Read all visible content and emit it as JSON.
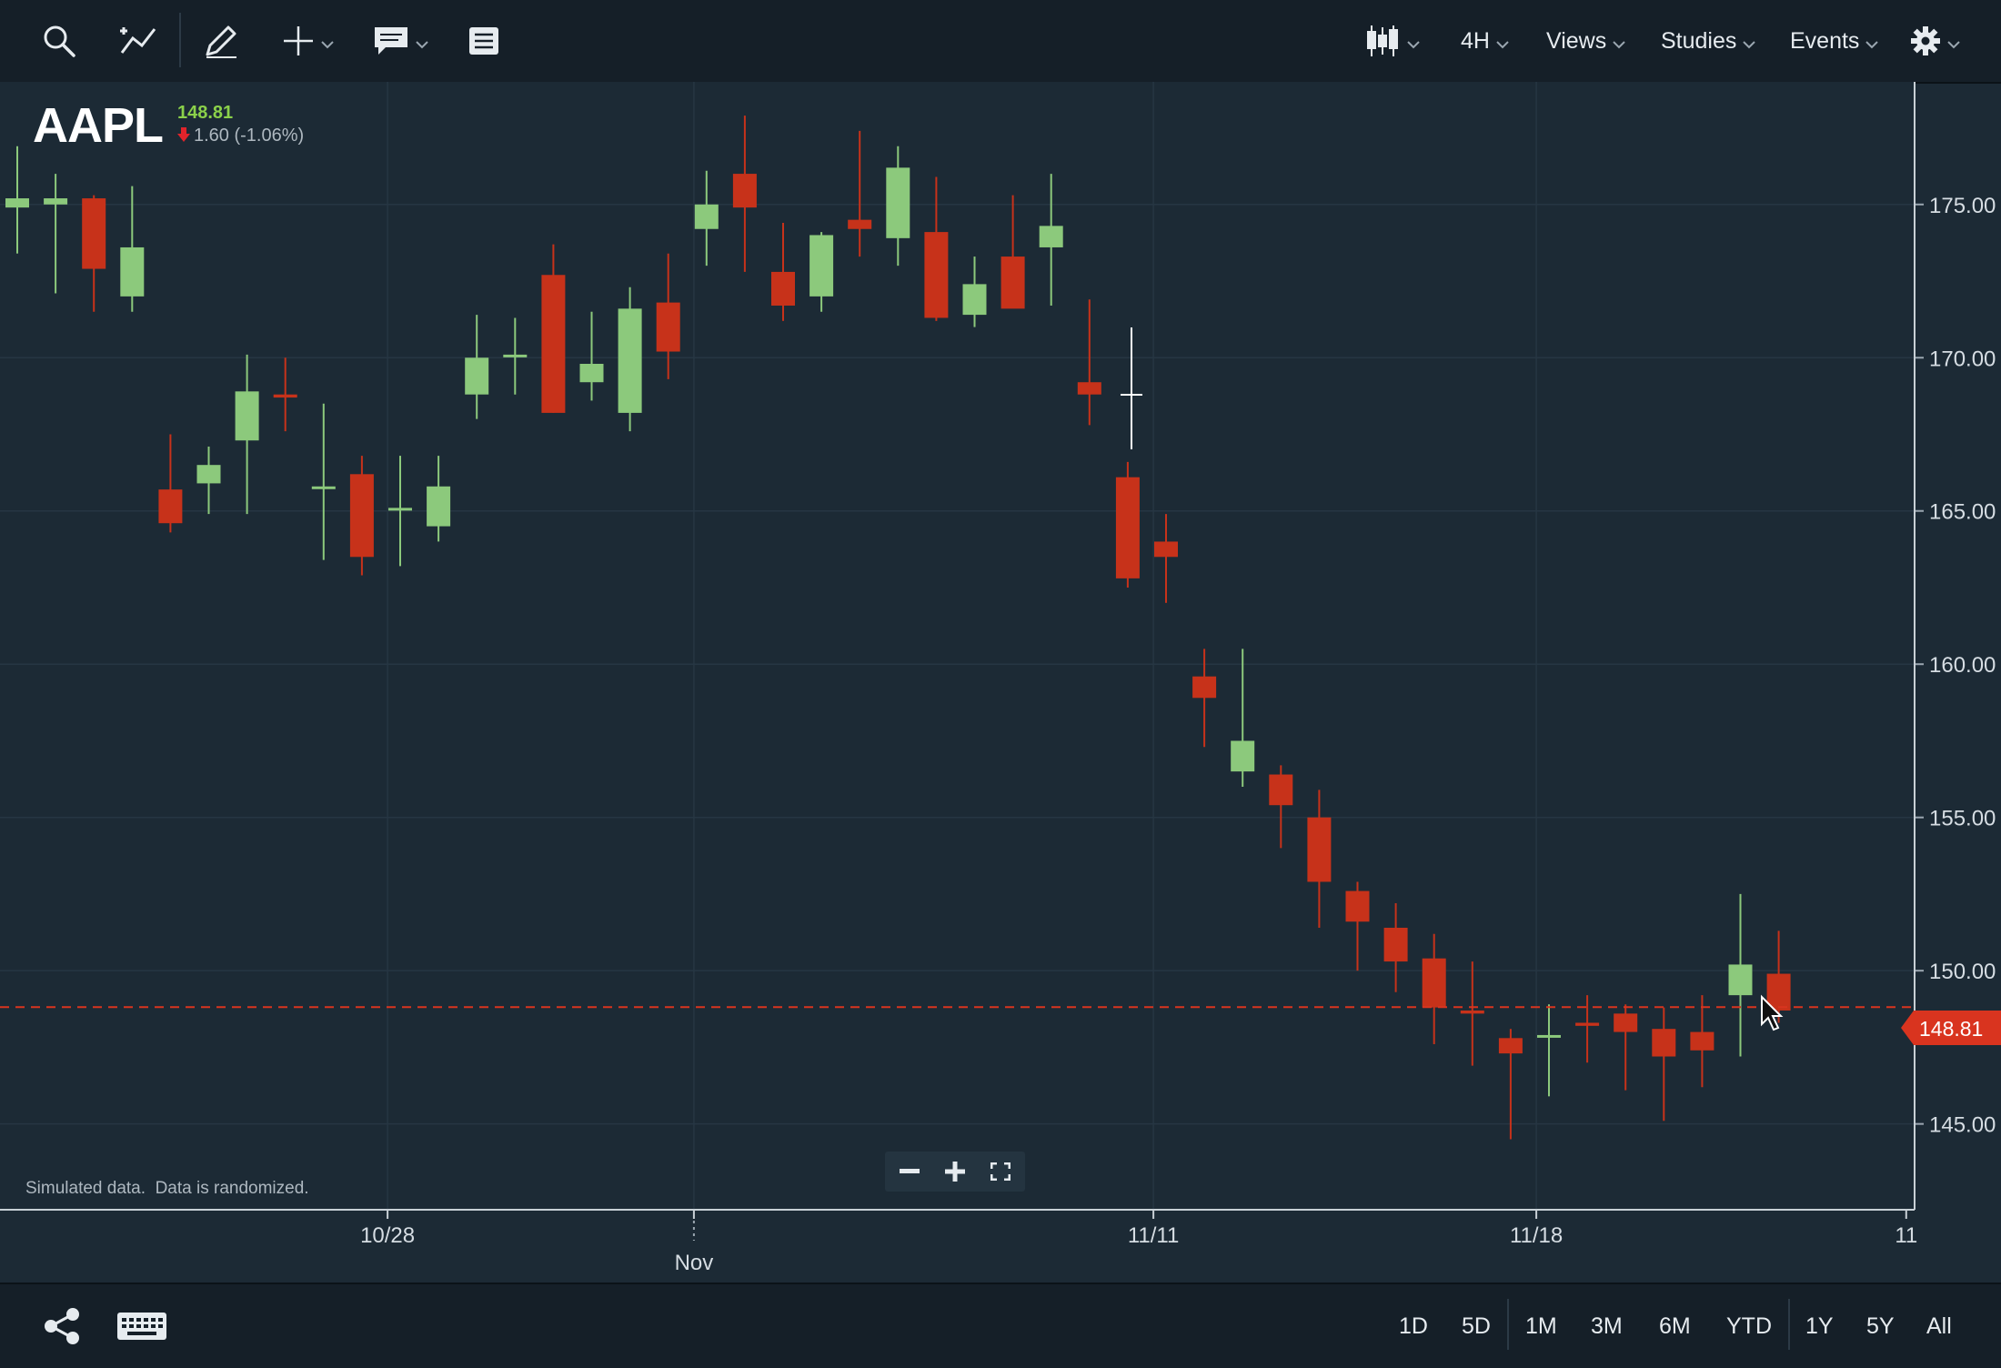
{
  "toolbar": {
    "icons": [
      "search-icon",
      "trendline-icon",
      "pencil-icon",
      "crosshair-icon",
      "comment-icon",
      "news-icon"
    ],
    "chart_type_icon": "candlestick-icon",
    "interval_label": "4H",
    "views_label": "Views",
    "studies_label": "Studies",
    "events_label": "Events",
    "settings_icon": "gear-icon"
  },
  "quote": {
    "symbol": "AAPL",
    "last_price": "148.81",
    "change": "1.60 (-1.06%)",
    "direction": "down"
  },
  "notice": "Simulated data.  Data is randomized.",
  "price_badge": "148.81",
  "colors": {
    "background": "#1c2a35",
    "up": "#8cc97c",
    "down": "#c7321a",
    "price_line": "#d9341f",
    "quote_up_text": "#8bd14a",
    "down_arrow": "#e0242b"
  },
  "chart_data": {
    "type": "candlestick",
    "symbol": "AAPL",
    "interval": "4H",
    "ylim": [
      142.2,
      179.0
    ],
    "y_ticks": [
      "175.00",
      "170.00",
      "165.00",
      "160.00",
      "155.00",
      "150.00",
      "145.00"
    ],
    "y_tick_values": [
      175,
      170,
      165,
      160,
      155,
      150,
      145
    ],
    "x_tick_labels": [
      {
        "label": "10/28",
        "index": 9.67
      },
      {
        "label": "Nov",
        "index": 17.67
      },
      {
        "label": "11/11",
        "index": 29.67
      },
      {
        "label": "11/18",
        "index": 39.67
      },
      {
        "label": "11",
        "index": 49.33
      }
    ],
    "last_price": 148.81,
    "candles": [
      {
        "o": 174.9,
        "h": 176.9,
        "l": 173.4,
        "c": 175.2
      },
      {
        "o": 175.0,
        "h": 176.0,
        "l": 172.1,
        "c": 175.2
      },
      {
        "o": 175.2,
        "h": 175.3,
        "l": 171.5,
        "c": 172.9
      },
      {
        "o": 172.0,
        "h": 175.6,
        "l": 171.5,
        "c": 173.6
      },
      {
        "o": 165.7,
        "h": 167.5,
        "l": 164.3,
        "c": 164.6
      },
      {
        "o": 165.9,
        "h": 167.1,
        "l": 164.9,
        "c": 166.5
      },
      {
        "o": 167.3,
        "h": 170.1,
        "l": 164.9,
        "c": 168.9
      },
      {
        "o": 168.8,
        "h": 170.0,
        "l": 167.6,
        "c": 168.7
      },
      {
        "o": 165.8,
        "h": 168.5,
        "l": 163.4,
        "c": 165.8
      },
      {
        "o": 166.2,
        "h": 166.8,
        "l": 162.9,
        "c": 163.5
      },
      {
        "o": 165.1,
        "h": 166.8,
        "l": 163.2,
        "c": 165.1
      },
      {
        "o": 164.5,
        "h": 166.8,
        "l": 164.0,
        "c": 165.8
      },
      {
        "o": 168.8,
        "h": 171.4,
        "l": 168.0,
        "c": 170.0
      },
      {
        "o": 170.1,
        "h": 171.3,
        "l": 168.8,
        "c": 170.1
      },
      {
        "o": 172.7,
        "h": 173.7,
        "l": 168.2,
        "c": 168.2
      },
      {
        "o": 169.2,
        "h": 171.5,
        "l": 168.6,
        "c": 169.8
      },
      {
        "o": 168.2,
        "h": 172.3,
        "l": 167.6,
        "c": 171.6
      },
      {
        "o": 171.8,
        "h": 173.4,
        "l": 169.3,
        "c": 170.2
      },
      {
        "o": 174.2,
        "h": 176.1,
        "l": 173.0,
        "c": 175.0
      },
      {
        "o": 176.0,
        "h": 177.9,
        "l": 172.8,
        "c": 174.9
      },
      {
        "o": 172.8,
        "h": 174.4,
        "l": 171.2,
        "c": 171.7
      },
      {
        "o": 172.0,
        "h": 174.1,
        "l": 171.5,
        "c": 174.0
      },
      {
        "o": 174.5,
        "h": 177.4,
        "l": 173.3,
        "c": 174.2
      },
      {
        "o": 173.9,
        "h": 176.9,
        "l": 173.0,
        "c": 176.2
      },
      {
        "o": 174.1,
        "h": 175.9,
        "l": 171.2,
        "c": 171.3
      },
      {
        "o": 171.4,
        "h": 173.3,
        "l": 171.0,
        "c": 172.4
      },
      {
        "o": 173.3,
        "h": 175.3,
        "l": 172.1,
        "c": 171.6
      },
      {
        "o": 173.6,
        "h": 176.0,
        "l": 171.7,
        "c": 174.3
      },
      {
        "o": 169.2,
        "h": 171.9,
        "l": 167.8,
        "c": 168.8
      }
    ],
    "candles_2": [
      {
        "o": 166.1,
        "h": 166.6,
        "l": 162.5,
        "c": 162.8
      },
      {
        "o": 164.0,
        "h": 164.9,
        "l": 162.0,
        "c": 163.5
      },
      {
        "o": 159.6,
        "h": 160.5,
        "l": 157.3,
        "c": 158.9
      },
      {
        "o": 156.5,
        "h": 160.5,
        "l": 156.0,
        "c": 157.5
      },
      {
        "o": 156.4,
        "h": 156.7,
        "l": 154.0,
        "c": 155.4
      },
      {
        "o": 155.0,
        "h": 155.9,
        "l": 151.4,
        "c": 152.9
      },
      {
        "o": 152.6,
        "h": 152.9,
        "l": 150.0,
        "c": 151.6
      },
      {
        "o": 151.4,
        "h": 152.2,
        "l": 149.3,
        "c": 150.3
      },
      {
        "o": 150.4,
        "h": 151.2,
        "l": 147.6,
        "c": 148.8
      },
      {
        "o": 148.7,
        "h": 150.3,
        "l": 146.9,
        "c": 148.6
      },
      {
        "o": 147.8,
        "h": 148.1,
        "l": 144.5,
        "c": 147.3
      },
      {
        "o": 147.9,
        "h": 148.9,
        "l": 145.9,
        "c": 147.9
      },
      {
        "o": 148.3,
        "h": 149.2,
        "l": 147.0,
        "c": 148.2
      },
      {
        "o": 148.6,
        "h": 148.9,
        "l": 146.1,
        "c": 148.0
      },
      {
        "o": 148.1,
        "h": 148.8,
        "l": 145.1,
        "c": 147.2
      },
      {
        "o": 148.0,
        "h": 149.2,
        "l": 146.2,
        "c": 147.4
      },
      {
        "o": 149.2,
        "h": 152.5,
        "l": 147.2,
        "c": 150.2
      },
      {
        "o": 149.9,
        "h": 151.3,
        "l": 148.3,
        "c": 148.7
      }
    ]
  },
  "footer": {
    "share_icon": "share-icon",
    "keyboard_icon": "keyboard-icon",
    "ranges": [
      "1D",
      "5D",
      "1M",
      "3M",
      "6M",
      "YTD",
      "1Y",
      "5Y",
      "All"
    ]
  },
  "zoom_controls": [
    "zoom-out-icon",
    "zoom-in-icon",
    "fullscreen-icon"
  ]
}
